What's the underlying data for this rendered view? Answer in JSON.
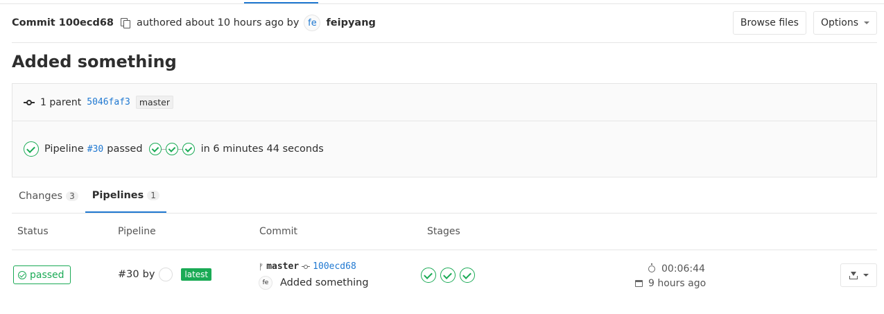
{
  "header": {
    "commit_label": "Commit 100ecd68",
    "authored_text": "authored about 10 hours ago by",
    "author_initials": "fe",
    "author_name": "feipyang",
    "browse_files_label": "Browse files",
    "options_label": "Options"
  },
  "commit": {
    "title": "Added something",
    "parent_text": "1 parent",
    "parent_sha": "5046faf3",
    "branch": "master",
    "pipeline_prefix": "Pipeline",
    "pipeline_id": "#30",
    "pipeline_status": "passed",
    "pipeline_duration": "in 6 minutes 44 seconds"
  },
  "tabs": [
    {
      "label": "Changes",
      "count": "3"
    },
    {
      "label": "Pipelines",
      "count": "1"
    }
  ],
  "table": {
    "headers": [
      "Status",
      "Pipeline",
      "Commit",
      "Stages"
    ],
    "row": {
      "status": "passed",
      "pipeline_id": "#30",
      "by": "by",
      "latest_badge": "latest",
      "ref": "master",
      "sha": "100ecd68",
      "author_initials": "fe",
      "commit_title": "Added something",
      "duration": "00:06:44",
      "finished": "9 hours ago"
    }
  },
  "colors": {
    "success": "#1aaa55",
    "link": "#1f78d1"
  }
}
